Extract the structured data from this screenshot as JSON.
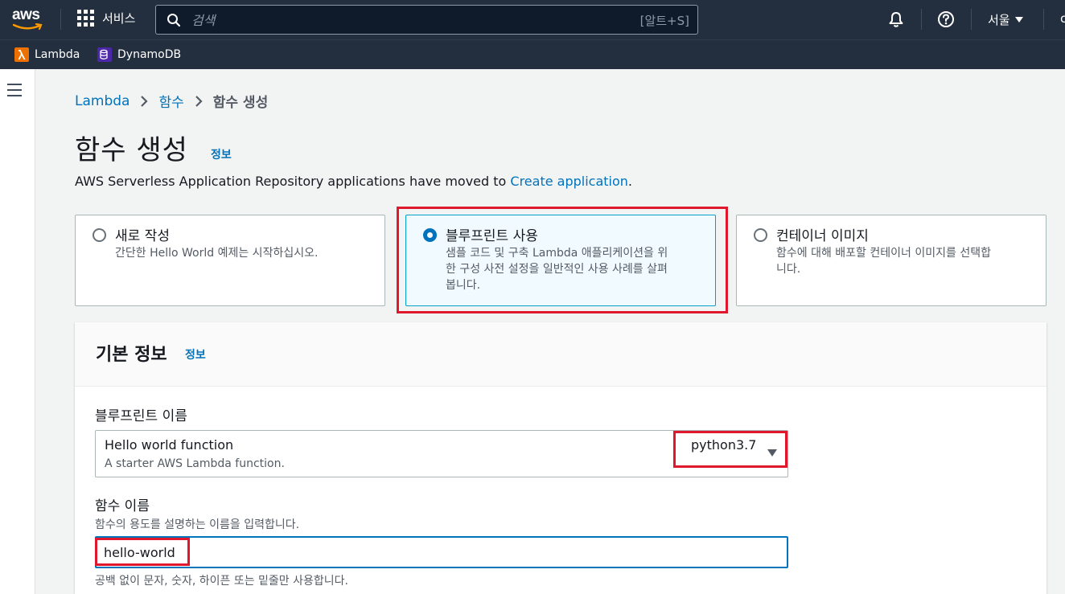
{
  "topnav": {
    "logo_text": "aws",
    "services_label": "서비스",
    "search_placeholder": "검색",
    "search_shortcut": "[알트+S]",
    "region": "서울",
    "edge_text": "c"
  },
  "favorites": [
    {
      "label": "Lambda",
      "color": "#ed7100"
    },
    {
      "label": "DynamoDB",
      "color": "#4d27aa"
    }
  ],
  "breadcrumb": {
    "items": [
      "Lambda",
      "함수"
    ],
    "current": "함수 생성"
  },
  "page": {
    "title": "함수 생성",
    "info": "정보",
    "notice_text": "AWS Serverless Application Repository applications have moved to ",
    "notice_link": "Create application",
    "notice_end": "."
  },
  "options": [
    {
      "title": "새로 작성",
      "desc": "간단한 Hello World 예제는 시작하십시오.",
      "selected": false
    },
    {
      "title": "블루프린트 사용",
      "desc": "샘플 코드 및 구축 Lambda 애플리케이션을 위한 구성 사전 설정을 일반적인 사용 사례를 살펴봅니다.",
      "desc_lines": [
        "샘플 코드 및 구축 Lambda 애플리케이션을 위",
        "한 구성 사전 설정을 일반적인 사용 사례를 살펴",
        "봅니다."
      ],
      "selected": true
    },
    {
      "title": "컨테이너 이미지",
      "desc_lines": [
        "함수에 대해 배포할 컨테이너 이미지를 선택합",
        "니다."
      ],
      "selected": false
    }
  ],
  "basic_info": {
    "title": "기본 정보",
    "info": "정보",
    "blueprint_label": "블루프린트 이름",
    "blueprint_name": "Hello world function",
    "blueprint_desc": "A starter AWS Lambda function.",
    "runtime": "python3.7",
    "function_name_label": "함수 이름",
    "function_name_desc": "함수의 용도를 설명하는 이름을 입력합니다.",
    "function_name_value": "hello-world",
    "function_name_hint": "공백 없이 문자, 숫자, 하이픈 또는 밑줄만 사용합니다."
  },
  "colors": {
    "nav_bg": "#232f3e",
    "link": "#0073bb",
    "highlight": "#e0182d",
    "selected_bg": "#f1faff"
  }
}
